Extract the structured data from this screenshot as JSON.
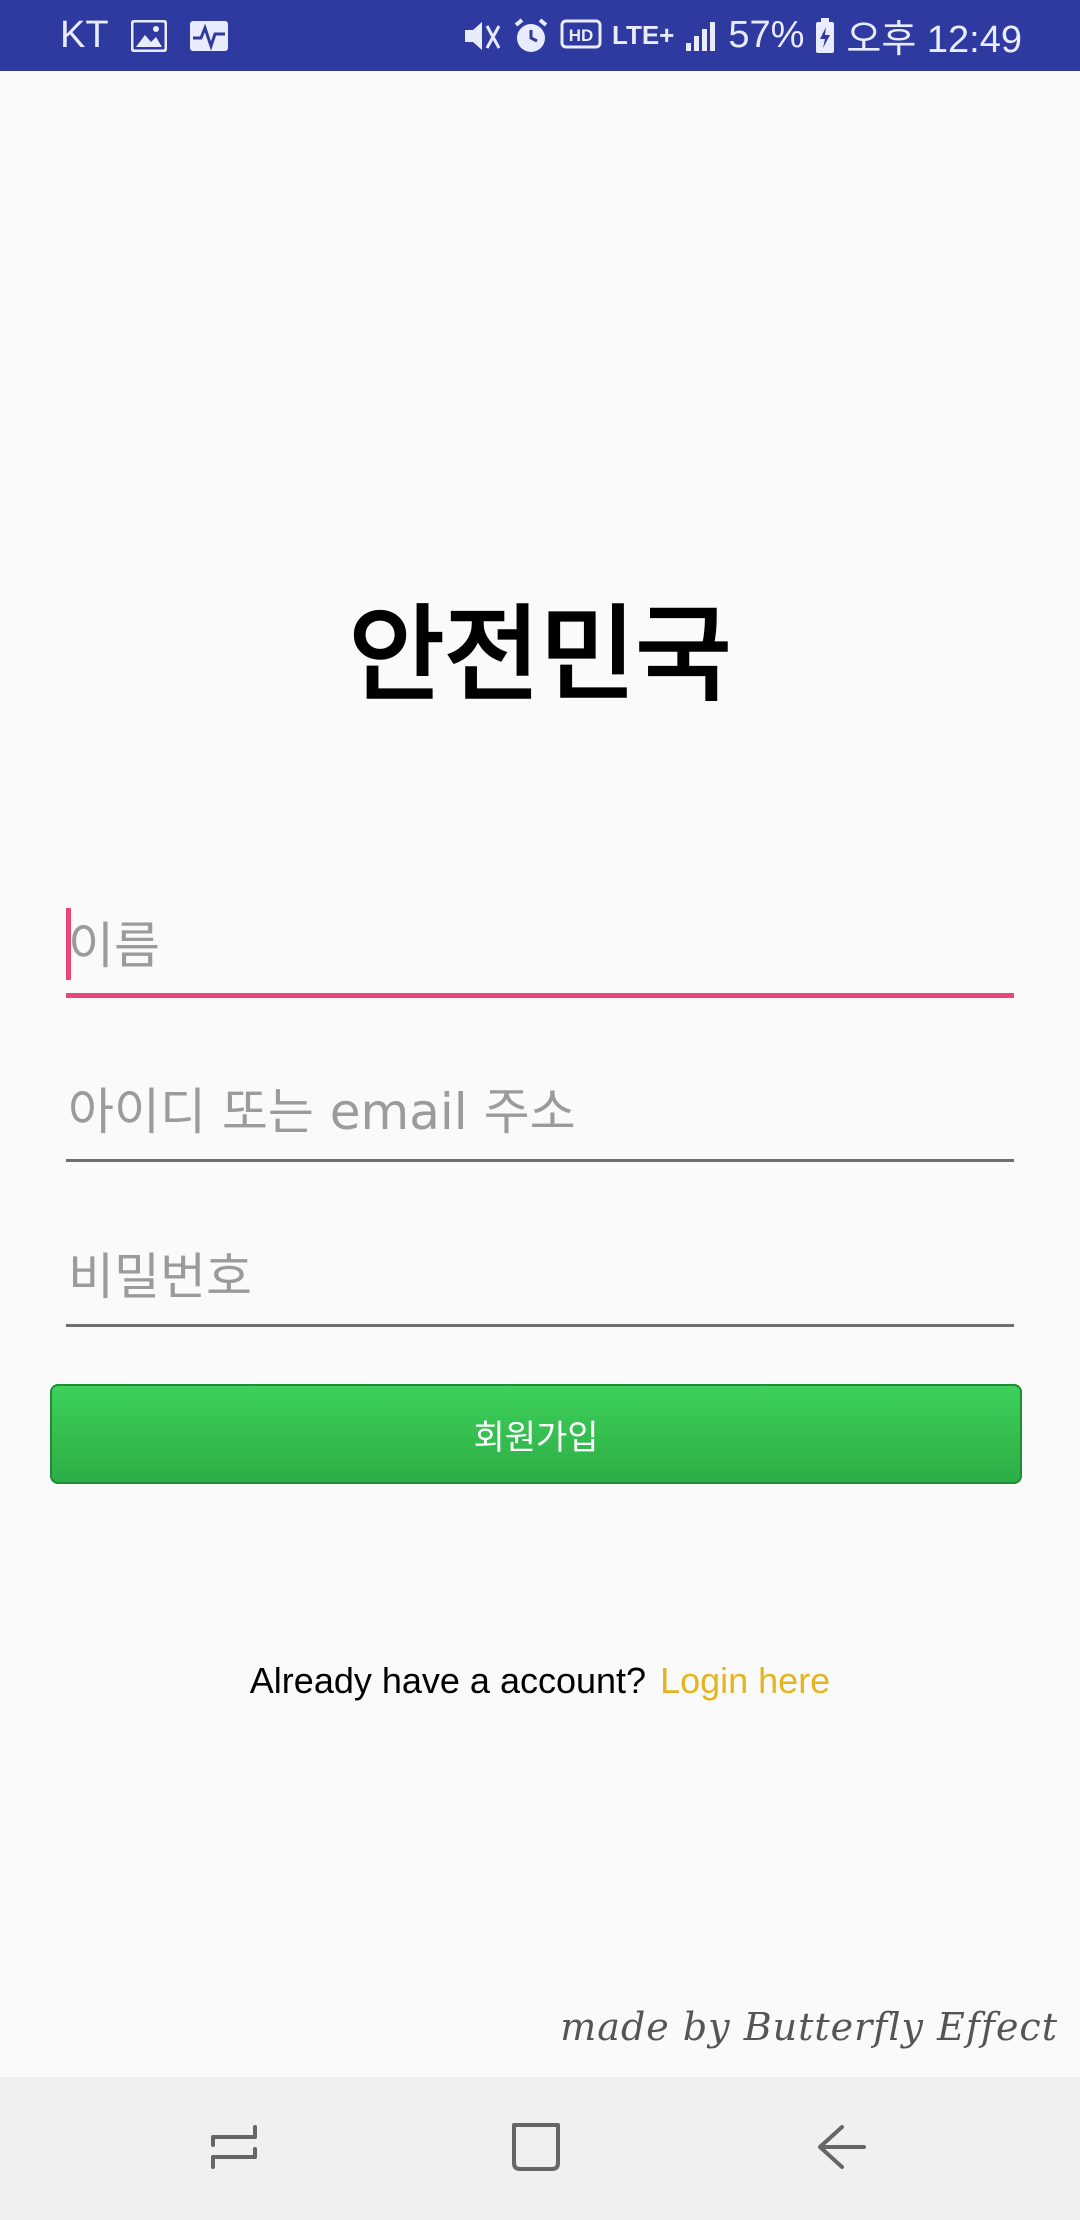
{
  "status_bar": {
    "carrier": "KT",
    "battery": "57%",
    "time": "오후 12:49",
    "network": "LTE+",
    "hd": "HD",
    "icons": [
      "image-icon",
      "activity-icon",
      "mute-icon",
      "alarm-icon",
      "hd-icon",
      "lte-icon",
      "signal-icon",
      "battery-icon"
    ]
  },
  "app": {
    "title": "안전민국"
  },
  "form": {
    "name_placeholder": "이름",
    "id_placeholder": "아이디 또는 email 주소",
    "password_placeholder": "비밀번호",
    "signup_label": "회원가입"
  },
  "login": {
    "prompt": "Already have a account?",
    "link": "Login here"
  },
  "footer": {
    "credit": "made by Butterfly Effect"
  },
  "nav": {
    "icons": [
      "recent-apps-icon",
      "home-icon",
      "back-icon"
    ]
  },
  "colors": {
    "status_bar": "#2e3aa0",
    "accent": "#e8457a",
    "button": "#34c04f",
    "link": "#e5b51f"
  }
}
